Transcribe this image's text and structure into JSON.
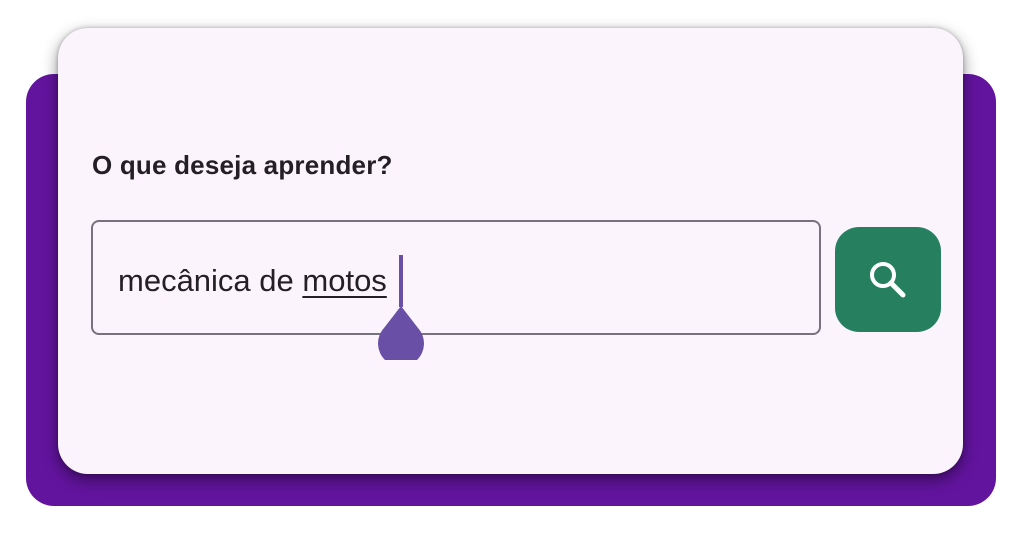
{
  "form": {
    "question_label": "O que deseja aprender?",
    "search_value_plain": "mecânica de ",
    "search_value_composing": "motos",
    "search_button_icon": "search-icon"
  },
  "colors": {
    "backdrop": "#63149f",
    "card": "#fbf4fd",
    "button": "#268060",
    "cursor": "#6a4fa6"
  }
}
